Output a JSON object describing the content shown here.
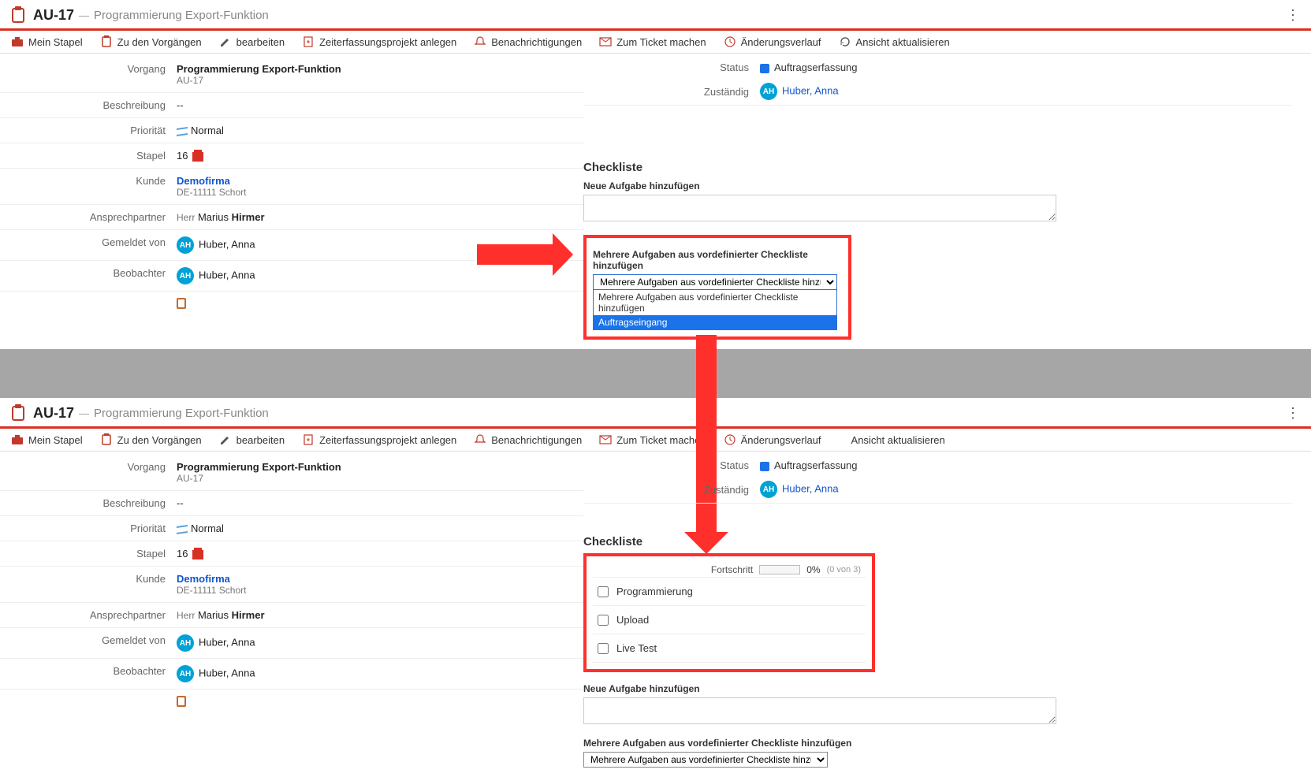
{
  "ticket": {
    "id": "AU-17",
    "title": "Programmierung Export-Funktion"
  },
  "toolbar": {
    "mein_stapel": "Mein Stapel",
    "zu_vorgaengen": "Zu den Vorgängen",
    "bearbeiten": "bearbeiten",
    "zeiterfassung": "Zeiterfassungsprojekt anlegen",
    "benachrichtigungen": "Benachrichtigungen",
    "zum_ticket": "Zum Ticket machen",
    "aenderung": "Änderungsverlauf",
    "aktualisieren": "Ansicht aktualisieren"
  },
  "fields": {
    "vorgang_label": "Vorgang",
    "vorgang_title": "Programmierung Export-Funktion",
    "vorgang_id": "AU-17",
    "beschreibung_label": "Beschreibung",
    "beschreibung_value": "--",
    "prioritaet_label": "Priorität",
    "prioritaet_value": "Normal",
    "stapel_label": "Stapel",
    "stapel_value": "16",
    "kunde_label": "Kunde",
    "kunde_name": "Demofirma",
    "kunde_sub": "DE-11111 Schort",
    "ansprech_label": "Ansprechpartner",
    "ansprech_prefix": "Herr",
    "ansprech_first": "Marius",
    "ansprech_last": "Hirmer",
    "gemeldet_label": "Gemeldet von",
    "beobachter_label": "Beobachter",
    "user_initials": "AH",
    "user_name": "Huber, Anna"
  },
  "right_meta": {
    "status_label": "Status",
    "status_value": "Auftragserfassung",
    "zustaendig_label": "Zuständig"
  },
  "checklist": {
    "heading": "Checkliste",
    "new_task_label": "Neue Aufgabe hinzufügen",
    "multi_label": "Mehrere Aufgaben aus vordefinierter Checkliste hinzufügen",
    "select_placeholder": "Mehrere Aufgaben aus vordefinierter Checkliste hinzufügen",
    "dropdown_options": [
      "Mehrere Aufgaben aus vordefinierter Checkliste hinzufügen",
      "Auftragseingang"
    ],
    "progress_label": "Fortschritt",
    "progress_pct": "0%",
    "progress_sub": "(0 von 3)",
    "items": [
      "Programmierung",
      "Upload",
      "Live Test"
    ]
  }
}
